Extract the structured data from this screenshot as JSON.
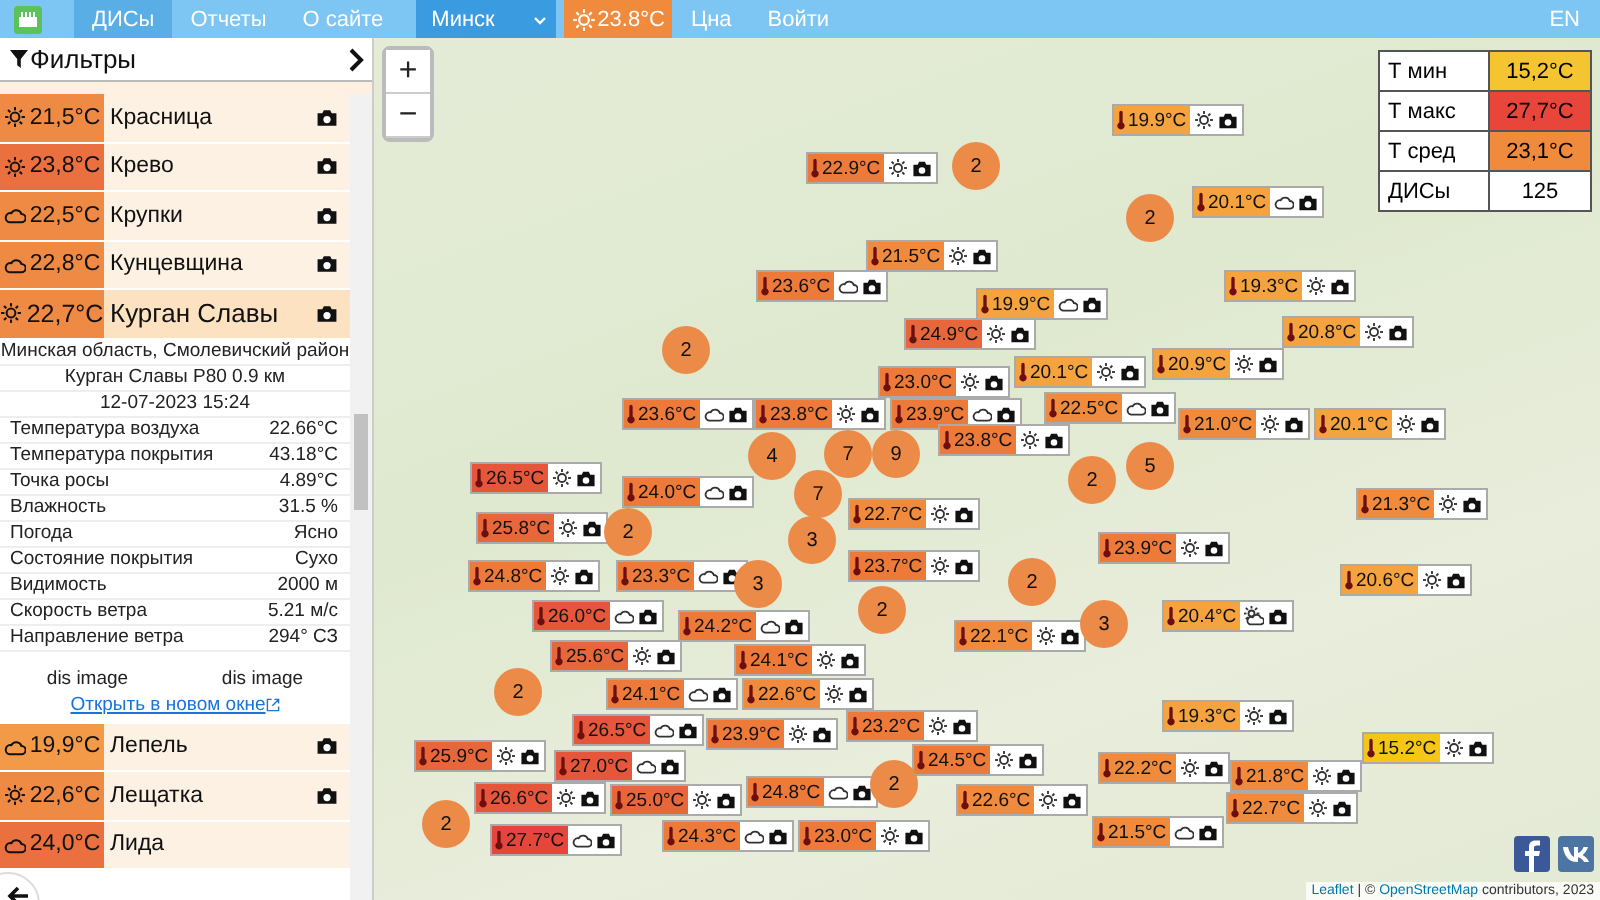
{
  "nav": {
    "items": [
      {
        "label": "ДИСы",
        "selected": true
      },
      {
        "label": "Отчеты",
        "selected": false
      },
      {
        "label": "О сайте",
        "selected": false
      }
    ],
    "city": {
      "value": "Минск"
    },
    "weather_badge": {
      "temp": "23.8°C",
      "weather": {
        "kind": "sun"
      }
    },
    "links": [
      "Цна",
      "Войти"
    ],
    "language": "EN"
  },
  "sidebar": {
    "title": "Фильтры",
    "stations": [
      {
        "temp": "21,5°C",
        "weather": {
          "kind": "sun"
        },
        "name": "Красница",
        "camera": true,
        "selected": false,
        "color": "#ee8a44"
      },
      {
        "temp": "23,8°C",
        "weather": {
          "kind": "sun"
        },
        "name": "Крево",
        "camera": true,
        "selected": false,
        "color": "#ea7040"
      },
      {
        "temp": "22,5°C",
        "weather": {
          "kind": "cloud"
        },
        "name": "Крупки",
        "camera": true,
        "selected": false,
        "color": "#ee8a44"
      },
      {
        "temp": "22,8°C",
        "weather": {
          "kind": "cloud"
        },
        "name": "Кунцевщина",
        "camera": true,
        "selected": false,
        "color": "#ee8a44"
      },
      {
        "temp": "22,7°C",
        "weather": {
          "kind": "sun"
        },
        "name": "Курган Славы",
        "camera": true,
        "selected": true,
        "color": "#ee8a44"
      }
    ],
    "details": {
      "region": "Минская область, Смолевичский район",
      "nearest": "Курган Славы Р80 0.9 км",
      "datetime": "12-07-2023 15:24",
      "rows": [
        {
          "label": "Температура воздуха",
          "value": "22.66°C"
        },
        {
          "label": "Температура покрытия",
          "value": "43.18°C"
        },
        {
          "label": "Точка росы",
          "value": "4.89°C"
        },
        {
          "label": "Влажность",
          "value": "31.5 %"
        },
        {
          "label": "Погода",
          "value": "Ясно"
        },
        {
          "label": "Состояние покрытия",
          "value": "Сухо"
        },
        {
          "label": "Видимость",
          "value": "2000 м"
        },
        {
          "label": "Скорость ветра",
          "value": "5.21 м/с"
        },
        {
          "label": "Направление ветра",
          "value": "294° СЗ"
        }
      ],
      "images": [
        "dis image",
        "dis image"
      ],
      "link": "Открыть в новом окне"
    },
    "stations_after": [
      {
        "temp": "19,9°C",
        "weather": {
          "kind": "cloud"
        },
        "name": "Лепель",
        "camera": true,
        "selected": false,
        "color": "#f29a48"
      },
      {
        "temp": "22,6°C",
        "weather": {
          "kind": "sun"
        },
        "name": "Лещатка",
        "camera": true,
        "selected": false,
        "color": "#ee8a44"
      },
      {
        "temp": "24,0°C",
        "weather": {
          "kind": "cloud"
        },
        "name": "Лида",
        "camera": false,
        "selected": false,
        "color": "#ea7040"
      }
    ]
  },
  "map": {
    "zoom_in": "+",
    "zoom_out": "−",
    "markers": [
      {
        "temp": "22.9°C",
        "weather": {
          "kind": "sun"
        },
        "color": "#ee7a3a"
      },
      {
        "temp": "19.9°C",
        "weather": {
          "kind": "sun"
        },
        "color": "#f5a33f"
      },
      {
        "temp": "20.1°C",
        "weather": {
          "kind": "cloud"
        },
        "color": "#f5a33f"
      },
      {
        "temp": "21.5°C",
        "weather": {
          "kind": "sun"
        },
        "color": "#f08a3c"
      },
      {
        "temp": "23.6°C",
        "weather": {
          "kind": "cloud"
        },
        "color": "#ee7a3a"
      },
      {
        "temp": "19.3°C",
        "weather": {
          "kind": "sun"
        },
        "color": "#f5a33f"
      },
      {
        "temp": "19.9°C",
        "weather": {
          "kind": "cloud"
        },
        "color": "#f5a33f"
      },
      {
        "temp": "24.9°C",
        "weather": {
          "kind": "sun"
        },
        "color": "#e8673a"
      },
      {
        "temp": "20.8°C",
        "weather": {
          "kind": "sun"
        },
        "color": "#f5a33f"
      },
      {
        "temp": "20.9°C",
        "weather": {
          "kind": "sun"
        },
        "color": "#f5a33f"
      },
      {
        "temp": "23.0°C",
        "weather": {
          "kind": "sun"
        },
        "color": "#ee7a3a"
      },
      {
        "temp": "20.1°C",
        "weather": {
          "kind": "sun"
        },
        "color": "#f5a33f"
      },
      {
        "temp": "22.5°C",
        "weather": {
          "kind": "cloud"
        },
        "color": "#f08a3c"
      },
      {
        "temp": "21.0°C",
        "weather": {
          "kind": "sun"
        },
        "color": "#f08a3c"
      },
      {
        "temp": "20.1°C",
        "weather": {
          "kind": "sun"
        },
        "color": "#f5a33f"
      },
      {
        "temp": "23.6°C",
        "weather": {
          "kind": "cloud"
        },
        "color": "#ee7a3a"
      },
      {
        "temp": "23.8°C",
        "weather": {
          "kind": "sun"
        },
        "color": "#ee7a3a"
      },
      {
        "temp": "23.9°C",
        "weather": {
          "kind": "cloud"
        },
        "color": "#ee7a3a"
      },
      {
        "temp": "23.8°C",
        "weather": {
          "kind": "sun"
        },
        "color": "#ee7a3a"
      },
      {
        "temp": "26.5°C",
        "weather": {
          "kind": "sun"
        },
        "color": "#e5563a"
      },
      {
        "temp": "24.0°C",
        "weather": {
          "kind": "cloud"
        },
        "color": "#ee7a3a"
      },
      {
        "temp": "22.7°C",
        "weather": {
          "kind": "sun"
        },
        "color": "#f08a3c"
      },
      {
        "temp": "25.8°C",
        "weather": {
          "kind": "sun"
        },
        "color": "#e8673a"
      },
      {
        "temp": "21.3°C",
        "weather": {
          "kind": "sun"
        },
        "color": "#f08a3c"
      },
      {
        "temp": "23.9°C",
        "weather": {
          "kind": "sun"
        },
        "color": "#ee7a3a"
      },
      {
        "temp": "24.8°C",
        "weather": {
          "kind": "sun"
        },
        "color": "#ee7a3a"
      },
      {
        "temp": "23.3°C",
        "weather": {
          "kind": "cloud"
        },
        "color": "#ee7a3a"
      },
      {
        "temp": "23.7°C",
        "weather": {
          "kind": "sun"
        },
        "color": "#ee7a3a"
      },
      {
        "temp": "20.6°C",
        "weather": {
          "kind": "sun"
        },
        "color": "#f5a33f"
      },
      {
        "temp": "26.0°C",
        "weather": {
          "kind": "cloud"
        },
        "color": "#e5563a"
      },
      {
        "temp": "24.2°C",
        "weather": {
          "kind": "cloud"
        },
        "color": "#ee7a3a"
      },
      {
        "temp": "22.1°C",
        "weather": {
          "kind": "sun"
        },
        "color": "#f08a3c"
      },
      {
        "temp": "20.4°C",
        "weather": {
          "kind": "partly"
        },
        "color": "#f5a33f"
      },
      {
        "temp": "25.6°C",
        "weather": {
          "kind": "sun"
        },
        "color": "#e8673a"
      },
      {
        "temp": "24.1°C",
        "weather": {
          "kind": "sun"
        },
        "color": "#ee7a3a"
      },
      {
        "temp": "24.1°C",
        "weather": {
          "kind": "cloud"
        },
        "color": "#ee7a3a"
      },
      {
        "temp": "22.6°C",
        "weather": {
          "kind": "sun"
        },
        "color": "#f08a3c"
      },
      {
        "temp": "26.5°C",
        "weather": {
          "kind": "cloud"
        },
        "color": "#e5563a"
      },
      {
        "temp": "23.9°C",
        "weather": {
          "kind": "sun"
        },
        "color": "#ee7a3a"
      },
      {
        "temp": "23.2°C",
        "weather": {
          "kind": "sun"
        },
        "color": "#ee7a3a"
      },
      {
        "temp": "19.3°C",
        "weather": {
          "kind": "sun"
        },
        "color": "#f5a33f"
      },
      {
        "temp": "15.2°C",
        "weather": {
          "kind": "sun"
        },
        "color": "#f5c518"
      },
      {
        "temp": "25.9°C",
        "weather": {
          "kind": "sun"
        },
        "color": "#e8673a"
      },
      {
        "temp": "27.0°C",
        "weather": {
          "kind": "cloud"
        },
        "color": "#e5563a"
      },
      {
        "temp": "26.6°C",
        "weather": {
          "kind": "sun"
        },
        "color": "#e5563a"
      },
      {
        "temp": "25.0°C",
        "weather": {
          "kind": "sun"
        },
        "color": "#e8673a"
      },
      {
        "temp": "24.8°C",
        "weather": {
          "kind": "cloud"
        },
        "color": "#ee7a3a"
      },
      {
        "temp": "24.5°C",
        "weather": {
          "kind": "sun"
        },
        "color": "#ee7a3a"
      },
      {
        "temp": "22.6°C",
        "weather": {
          "kind": "sun"
        },
        "color": "#f08a3c"
      },
      {
        "temp": "22.2°C",
        "weather": {
          "kind": "sun"
        },
        "color": "#f08a3c"
      },
      {
        "temp": "21.5°C",
        "weather": {
          "kind": "cloud"
        },
        "color": "#f08a3c"
      },
      {
        "temp": "21.8°C",
        "weather": {
          "kind": "sun"
        },
        "color": "#f08a3c"
      },
      {
        "temp": "22.7°C",
        "weather": {
          "kind": "sun"
        },
        "color": "#f08a3c"
      },
      {
        "temp": "27.7°C",
        "weather": {
          "kind": "cloud"
        },
        "color": "#e5453a"
      },
      {
        "temp": "24.3°C",
        "weather": {
          "kind": "cloud"
        },
        "color": "#ee7a3a"
      },
      {
        "temp": "23.0°C",
        "weather": {
          "kind": "sun"
        },
        "color": "#ee7a3a"
      }
    ],
    "clusters": [
      "2",
      "2",
      "2",
      "4",
      "7",
      "7",
      "9",
      "2",
      "5",
      "2",
      "3",
      "3",
      "2",
      "2",
      "3",
      "2",
      "2",
      "2"
    ],
    "legend": [
      {
        "label": "Т мин",
        "value": "15,2°C",
        "color": "#f5c531"
      },
      {
        "label": "Т макс",
        "value": "27,7°C",
        "color": "#e8463a"
      },
      {
        "label": "Т сред",
        "value": "23,1°C",
        "color": "#f08a3c"
      },
      {
        "label": "ДИСы",
        "value": "125",
        "color": "#ffffff"
      }
    ],
    "attribution": {
      "leaflet": "Leaflet",
      "middle": "| ©",
      "osm": "OpenStreetMap",
      "suffix": "contributors, 2023"
    }
  }
}
